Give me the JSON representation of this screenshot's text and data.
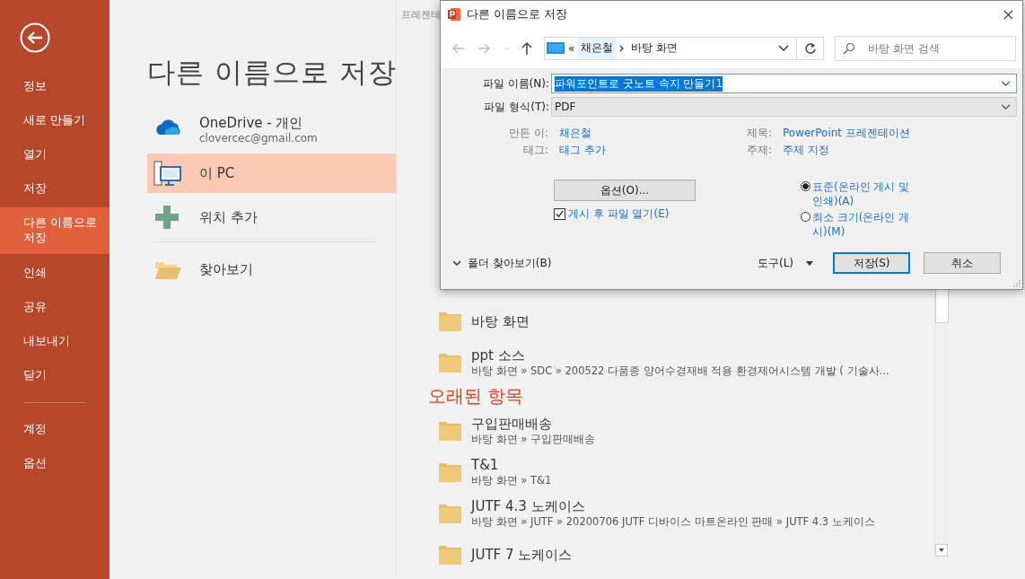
{
  "app_title": "프레젠테",
  "sidebar": {
    "items": [
      {
        "label": "정보",
        "selected": false
      },
      {
        "label": "새로 만들기",
        "selected": false
      },
      {
        "label": "열기",
        "selected": false
      },
      {
        "label": "저장",
        "selected": false
      },
      {
        "label": "다른 이름으로 저장",
        "selected": true
      },
      {
        "label": "인쇄",
        "selected": false
      },
      {
        "label": "공유",
        "selected": false
      },
      {
        "label": "내보내기",
        "selected": false
      },
      {
        "label": "닫기",
        "selected": false
      }
    ],
    "bottom_items": [
      {
        "label": "계정",
        "selected": false
      },
      {
        "label": "옵션",
        "selected": false
      }
    ]
  },
  "page_title": "다른 이름으로 저장",
  "locations": [
    {
      "kind": "cloud",
      "label": "OneDrive - 개인",
      "sublabel": "clovercec@gmail.com",
      "selected": false
    },
    {
      "kind": "pc",
      "label": "이 PC",
      "selected": true
    },
    {
      "kind": "add",
      "label": "위치 추가",
      "selected": false
    }
  ],
  "more_locations": [
    {
      "kind": "browse",
      "label": "찾아보기",
      "selected": false
    }
  ],
  "recent": {
    "items": [
      {
        "kind": "folder",
        "name": "바탕 화면"
      },
      {
        "kind": "folder",
        "name": "ppt 소스",
        "path": "바탕 화면 » SDC » 200522 다품종 양어수경재배 적용 환경제어시스템 개발 ( 기술사..."
      },
      {
        "kind": "heading",
        "name": "오래된 항목"
      },
      {
        "kind": "folder",
        "name": "구입판매배송",
        "path": "바탕 화면 » 구입판매배송"
      },
      {
        "kind": "folder",
        "name": "T&1",
        "path": "바탕 화면 » T&1"
      },
      {
        "kind": "folder",
        "name": "JUTF 4.3 노케이스",
        "path": "바탕 화면 » JUTF » 20200706 JUTF 디바이스 마트온라인 판매 » JUTF 4.3 노케이스"
      },
      {
        "kind": "folder",
        "name": "JUTF 7 노케이스"
      }
    ]
  },
  "dialog": {
    "title": "다른 이름으로 저장",
    "address": {
      "overflow": "«",
      "crumbs": [
        "채은철",
        "바탕 화면"
      ]
    },
    "search": {
      "placeholder": "바탕 화면 검색"
    },
    "file_name": {
      "label": "파일 이름(N):",
      "value": "파워포인트로 굿노트 속지 만들기1"
    },
    "file_type": {
      "label": "파일 형식(T):",
      "value": "PDF"
    },
    "meta_left": [
      {
        "label": "만든 이:",
        "value": "채은철"
      },
      {
        "label": "태그:",
        "value": "태그 추가"
      }
    ],
    "meta_right": [
      {
        "label": "제목:",
        "value": "PowerPoint 프레젠테이션"
      },
      {
        "label": "주제:",
        "value": "주제 지정"
      }
    ],
    "options_button": "옵션(O)...",
    "open_after": {
      "label": "게시 후 파일 열기(E)",
      "checked": true
    },
    "optimize": [
      {
        "label": "표준(온라인 게시 및 인쇄)(A)",
        "selected": true
      },
      {
        "label": "최소 크기(온라인 게시)(M)",
        "selected": false
      }
    ],
    "browse_toggle": "폴더 찾아보기(B)",
    "tools": "도구(L)",
    "save": "저장(S)",
    "cancel": "취소"
  }
}
